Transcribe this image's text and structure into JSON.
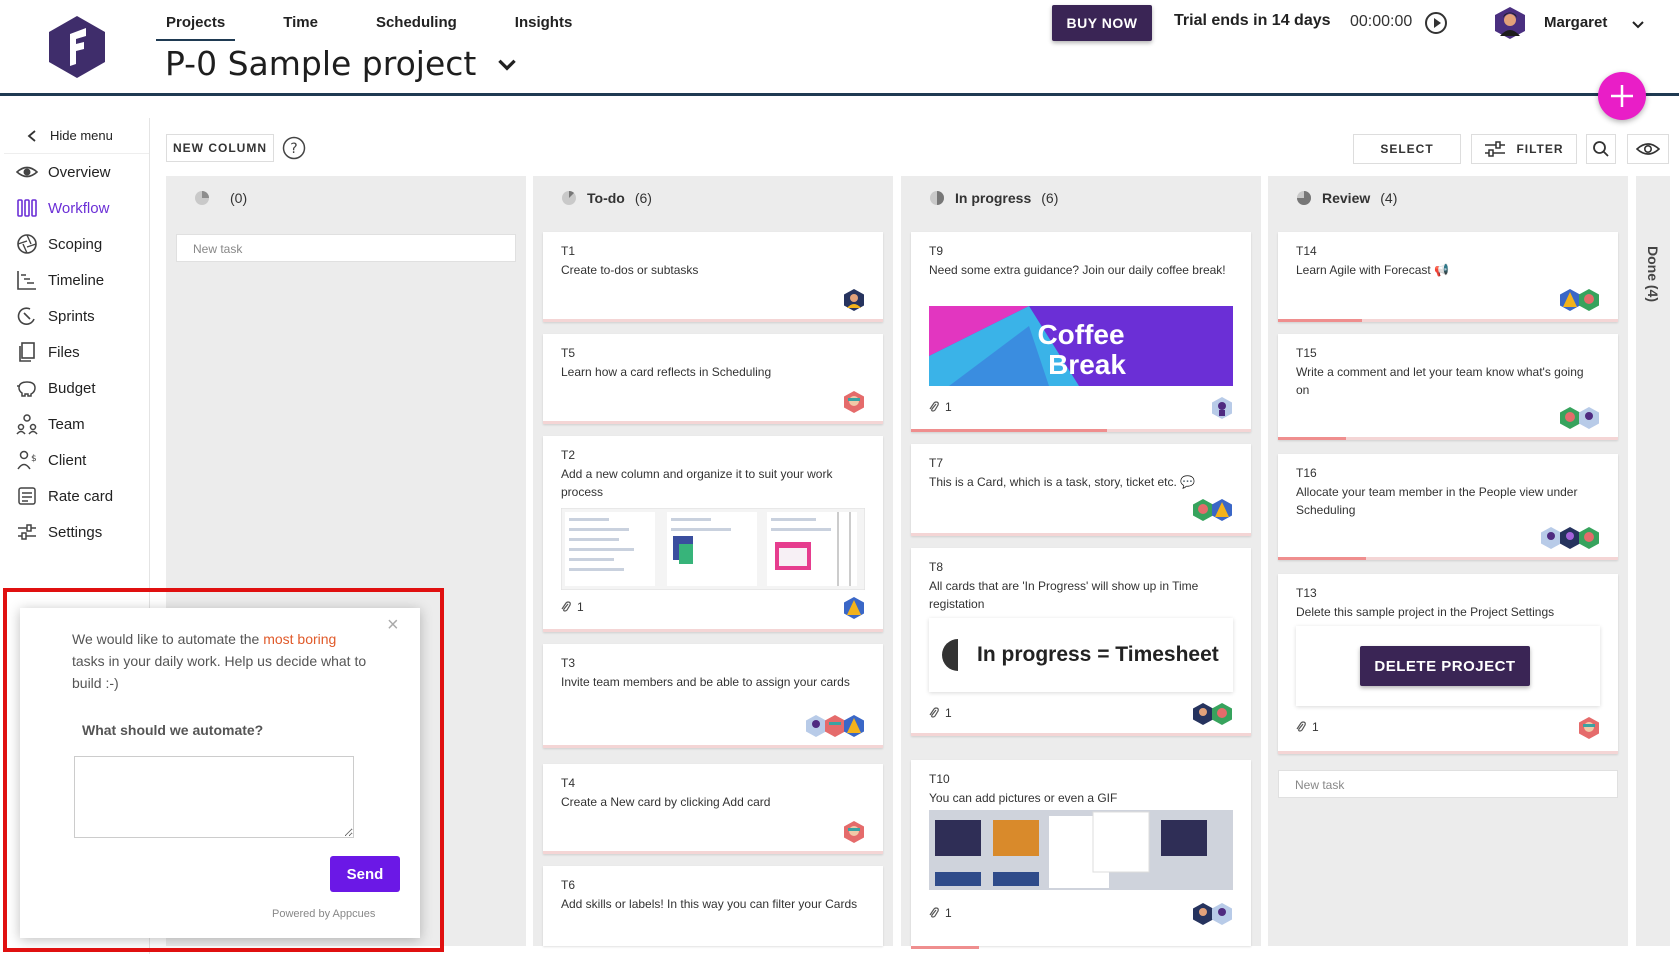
{
  "nav": {
    "tabs": [
      "Projects",
      "Time",
      "Scheduling",
      "Insights"
    ],
    "project_title": "P-0 Sample project"
  },
  "header": {
    "buy_now": "BUY NOW",
    "trial": "Trial ends in 14 days",
    "timer": "00:00:00",
    "user_name": "Margaret"
  },
  "sidebar": {
    "hide_menu": "Hide menu",
    "items": [
      {
        "label": "Overview",
        "icon": "eye-icon"
      },
      {
        "label": "Workflow",
        "icon": "columns-icon"
      },
      {
        "label": "Scoping",
        "icon": "aperture-icon"
      },
      {
        "label": "Timeline",
        "icon": "timeline-icon"
      },
      {
        "label": "Sprints",
        "icon": "sprint-icon"
      },
      {
        "label": "Files",
        "icon": "files-icon"
      },
      {
        "label": "Budget",
        "icon": "piggy-bank-icon"
      },
      {
        "label": "Team",
        "icon": "team-icon"
      },
      {
        "label": "Client",
        "icon": "client-icon"
      },
      {
        "label": "Rate card",
        "icon": "rate-card-icon"
      },
      {
        "label": "Settings",
        "icon": "settings-icon"
      }
    ]
  },
  "toolbar": {
    "new_column": "NEW COLUMN",
    "select": "SELECT",
    "filter": "FILTER"
  },
  "columns": [
    {
      "title": "",
      "count": "(0)",
      "new_task": "New task"
    },
    {
      "title": "To-do",
      "count": "(6)"
    },
    {
      "title": "In progress",
      "count": "(6)"
    },
    {
      "title": "Review",
      "count": "(4)",
      "new_task": "New task"
    }
  ],
  "done_label": "Done (4)",
  "cards": {
    "todo": [
      {
        "id": "T1",
        "title": "Create to-dos or subtasks"
      },
      {
        "id": "T5",
        "title": "Learn how a card reflects in Scheduling"
      },
      {
        "id": "T2",
        "title": "Add a new column and organize it to suit your work process",
        "attachments": "1"
      },
      {
        "id": "T3",
        "title": "Invite team members and be able to assign your cards"
      },
      {
        "id": "T4",
        "title": "Create a New card by clicking Add card"
      },
      {
        "id": "T6",
        "title": "Add skills or labels! In this way you can filter your Cards"
      }
    ],
    "inprogress": [
      {
        "id": "T9",
        "title": "Need some extra guidance? Join our daily coffee break!",
        "image_text_1": "Coffee",
        "image_text_2": "Break",
        "attachments": "1"
      },
      {
        "id": "T7",
        "title": "This is a Card, which is a task, story, ticket etc. 💬"
      },
      {
        "id": "T8",
        "title": "All cards that are 'In Progress' will show up in Time registation",
        "image_text": "In progress = Timesheet",
        "attachments": "1"
      },
      {
        "id": "T10",
        "title": "You can add pictures or even a GIF",
        "attachments": "1"
      }
    ],
    "review": [
      {
        "id": "T14",
        "title": "Learn Agile with Forecast 📢"
      },
      {
        "id": "T15",
        "title": "Write a comment and let your team know what's going on"
      },
      {
        "id": "T16",
        "title": "Allocate your team member in the People view under Scheduling"
      },
      {
        "id": "T13",
        "title": "Delete this sample project in the Project Settings",
        "button": "DELETE PROJECT",
        "attachments": "1"
      }
    ]
  },
  "appcues": {
    "text_before": "We would like to automate the ",
    "text_highlight": "most boring",
    "text_after": " tasks in your daily work. Help us decide what to build :-)",
    "question": "What should we automate?",
    "send": "Send",
    "powered": "Powered by Appcues"
  },
  "colors": {
    "brand_dark": "#3a2555",
    "accent_purple": "#6b2fd6",
    "fab_pink": "#e91ec7",
    "send_purple": "#6b18e6",
    "highlight_orange": "#e05a2a",
    "callout_red": "#e01010"
  }
}
